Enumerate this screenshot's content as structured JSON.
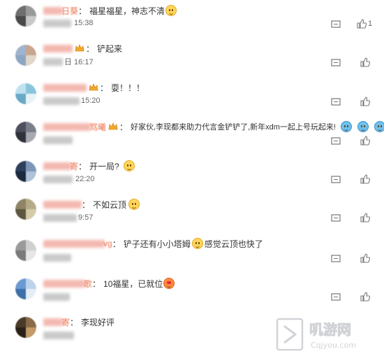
{
  "comments": [
    {
      "id": "c1",
      "name_suffix": "日葵",
      "crown": false,
      "colon": "：",
      "text": "福星福星，神志不清",
      "emojis": [
        "smile"
      ],
      "time_suffix": "15:38",
      "like_count": "1",
      "avatar": [
        "#6f6f6f",
        "#9a9a9a",
        "#4a4a4a",
        "#c9c9c9"
      ]
    },
    {
      "id": "c2",
      "name_suffix": "",
      "crown": true,
      "colon": "：",
      "text": "铲起来",
      "emojis": [],
      "time_suffix": "日 16:17",
      "like_count": "",
      "avatar": [
        "#a0b4cf",
        "#c8a68e",
        "#8da6c2",
        "#e2d6c9"
      ]
    },
    {
      "id": "c3",
      "name_suffix": "",
      "crown": true,
      "colon": "：",
      "text": "耍！！！",
      "emojis": [],
      "time_suffix": "15:20",
      "like_count": "",
      "avatar": [
        "#bfe2f0",
        "#8cc3dc",
        "#6aa9c6",
        "#e8f3f7"
      ]
    },
    {
      "id": "c4",
      "name_suffix": "骂曦",
      "crown": true,
      "colon": "：",
      "text": "好家伙,李现都来助力代言金铲铲了,新年xdm一起上号玩起来!",
      "emojis": [
        "cry",
        "cry",
        "cry"
      ],
      "time_suffix": "",
      "like_count": "",
      "avatar": [
        "#4d4f5c",
        "#7a7d8a",
        "#2f313b",
        "#a7a9b2"
      ]
    },
    {
      "id": "c5",
      "name_suffix": "寄",
      "crown": false,
      "colon": "：",
      "text": "开一局?",
      "emojis": [
        "smile"
      ],
      "time_suffix": "22:20",
      "like_count": "",
      "avatar": [
        "#2d3f5c",
        "#7c96b8",
        "#1c2a40",
        "#b0c2d8"
      ]
    },
    {
      "id": "c6",
      "name_suffix": "",
      "crown": false,
      "colon": "：",
      "text": "不如云顶",
      "emojis": [
        "smile"
      ],
      "time_suffix": "9:57",
      "like_count": "",
      "avatar": [
        "#8f8566",
        "#b5aa88",
        "#5e5640",
        "#d4cba9"
      ]
    },
    {
      "id": "c7",
      "name_suffix": "vg",
      "crown": false,
      "colon": "：",
      "text": "铲子还有小小塔姆",
      "emojis": [
        "smile"
      ],
      "text_after": "感觉云顶也快了",
      "time_suffix": "",
      "like_count": "",
      "avatar": [
        "#9a9a9a",
        "#cfcfcf",
        "#7a7a7a",
        "#e6e6e6"
      ]
    },
    {
      "id": "c8",
      "name_suffix": "歌",
      "crown": false,
      "colon": "：",
      "text": "10福星，已就位",
      "emojis": [
        "love"
      ],
      "time_suffix": "",
      "like_count": "",
      "avatar": [
        "#6a9ad0",
        "#bcd2ea",
        "#3f6fa8",
        "#e4eef8"
      ]
    },
    {
      "id": "c9",
      "name_suffix": "寄",
      "crown": false,
      "colon": "：",
      "text": "李现好评",
      "emojis": [],
      "time_suffix": "",
      "like_count": "",
      "avatar": [
        "#4a3a28",
        "#8a6a48",
        "#2a2018",
        "#c29a68"
      ]
    }
  ],
  "watermark": {
    "line1": "叽游网",
    "line2": "Cqjyou.com"
  }
}
